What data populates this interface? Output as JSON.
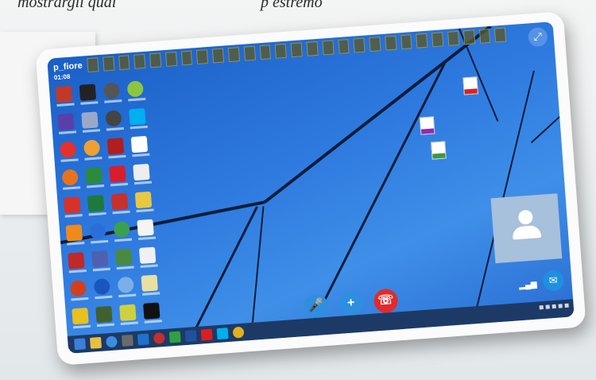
{
  "captions": {
    "left": "mostrargli qual",
    "right": "p estremo"
  },
  "call": {
    "username": "p_fiore",
    "duration": "01:08"
  },
  "icons": {
    "expand": "expand-icon",
    "self_view_avatar": "user-avatar-icon",
    "chat": "chat-icon",
    "signal": "signal-icon",
    "mic": "microphone-icon",
    "add": "plus-icon",
    "hang_up": "hang-up-icon"
  },
  "colors": {
    "desktop_blue": "#2f7be0",
    "call_button_blue": "#2e8fe0",
    "hang_up_red": "#e02c2c",
    "self_view_bg": "#a7c0dc"
  }
}
